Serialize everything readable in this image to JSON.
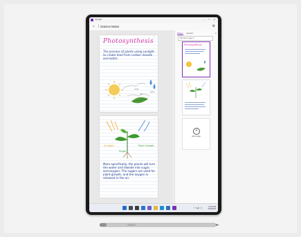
{
  "app": {
    "window_title": "Journal",
    "accent_color": "#7b2fb0",
    "min_icon": "minimize-icon",
    "max_icon": "maximize-icon",
    "close_icon": "close-icon"
  },
  "nav": {
    "home_icon": "home-icon",
    "separator": "|",
    "notebook_title": "Science Notes",
    "settings_icon": "gear-icon"
  },
  "pages": [
    {
      "title": "Photosynthesis",
      "body": "The process of plants using sunlight to create food from carbon dioxide and water.",
      "diagram_labels": [
        "CO2",
        "O2",
        "H2O"
      ],
      "controls": "⤢ ⋯"
    },
    {
      "body": "More specifically, the plants will turn the water and dioxide into sugar, and oxygen. The sugars are used for plant growth, and the oxygen is released in the air.",
      "diagram_labels": [
        "Sunlight",
        "Sugar",
        "Plant Growth"
      ],
      "controls": "⋯"
    }
  ],
  "page_panel": {
    "tabs": [
      {
        "label": "Pages",
        "active": true
      },
      {
        "label": "Search",
        "active": false
      }
    ],
    "selector_value": "Tap here to add / 1",
    "close_icon": "close-icon",
    "thumbnail_title": "Photosynthesis",
    "add_page_label": "Add a page"
  },
  "toolbar": {
    "tools": [
      {
        "name": "select-tool",
        "icon": "▭"
      },
      {
        "name": "pen-tool",
        "icon": "✎"
      },
      {
        "name": "highlighter-tool",
        "icon": "▮"
      },
      {
        "name": "eraser-tool",
        "icon": "◆"
      },
      {
        "name": "lasso-tool",
        "icon": "◌"
      },
      {
        "name": "undo-tool",
        "icon": "↶"
      },
      {
        "name": "redo-tool",
        "icon": "↷"
      }
    ]
  },
  "taskbar": {
    "icons": [
      {
        "name": "start-icon",
        "color": "#1f6fd1"
      },
      {
        "name": "search-icon",
        "color": "#4a4a4a"
      },
      {
        "name": "task-view-icon",
        "color": "#3b3b3b"
      },
      {
        "name": "widgets-icon",
        "color": "#2d73c8"
      },
      {
        "name": "chat-icon",
        "color": "#6b5bd6"
      },
      {
        "name": "file-explorer-icon",
        "color": "#e8b43a"
      },
      {
        "name": "edge-icon",
        "color": "#1a8fd1"
      },
      {
        "name": "store-icon",
        "color": "#2e6fb8"
      },
      {
        "name": "journal-icon",
        "color": "#7b2fb0"
      }
    ],
    "tray_icons": "⌃ ᯤ 🔊 🔋",
    "time": "11:50 AM",
    "date": "5/23/2022"
  }
}
